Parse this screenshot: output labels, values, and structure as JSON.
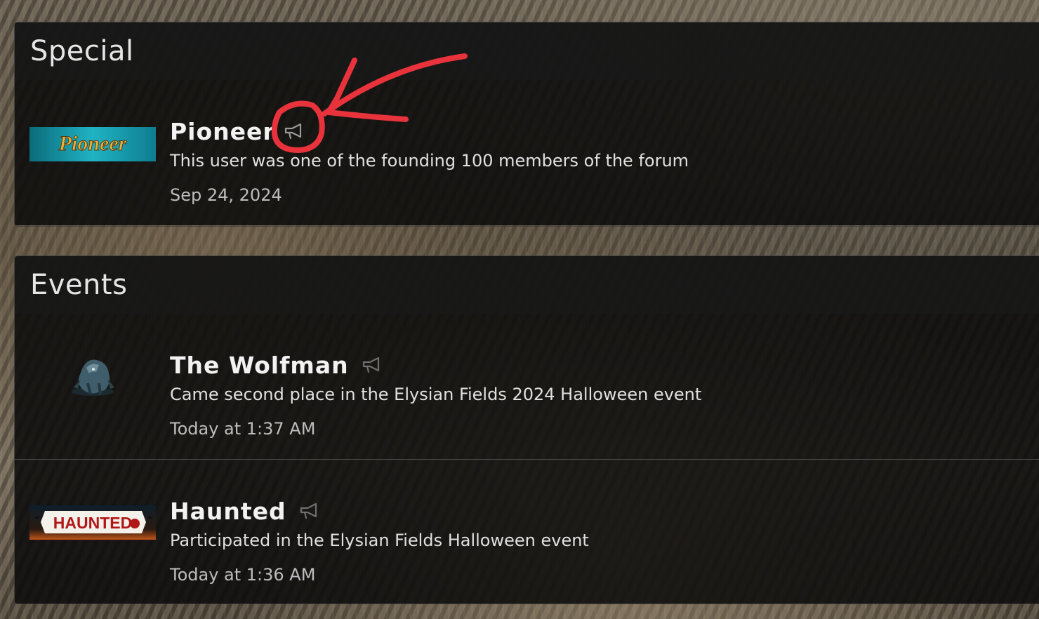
{
  "sections": [
    {
      "title": "Special",
      "trophies": [
        {
          "title": "Pioneer",
          "icon": "pioneer-banner-icon",
          "icon_text": "Pioneer",
          "description": "This user was one of the founding 100 members of the forum",
          "date": "Sep 24, 2024"
        }
      ]
    },
    {
      "title": "Events",
      "trophies": [
        {
          "title": "The Wolfman",
          "icon": "werewolf-icon",
          "description": "Came second place in the Elysian Fields 2024 Halloween event",
          "date": "Today at 1:37 AM"
        },
        {
          "title": "Haunted",
          "icon": "haunted-banner-icon",
          "icon_text": "HAUNTED",
          "description": "Participated in the Elysian Fields Halloween event",
          "date": "Today at 1:36 AM"
        }
      ]
    }
  ],
  "colors": {
    "annotation": "#e8323c",
    "header_bg": "#161616",
    "text_primary": "#f2f2f2",
    "text_muted": "#bdbdbd"
  }
}
